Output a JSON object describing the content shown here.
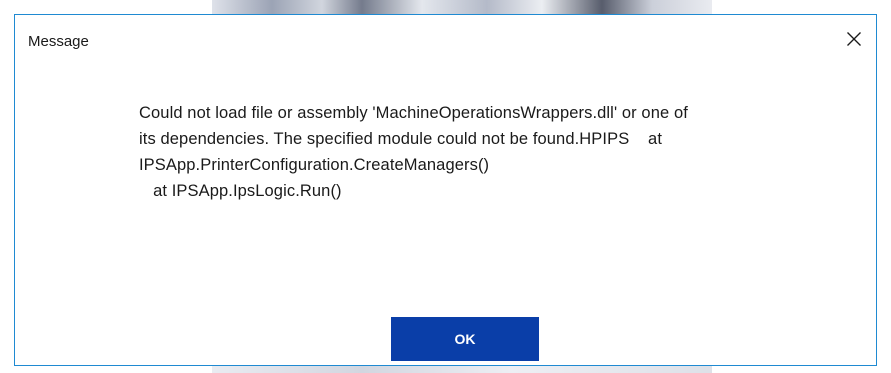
{
  "dialog": {
    "title": "Message",
    "message": "Could not load file or assembly 'MachineOperationsWrappers.dll' or one of\nits dependencies. The specified module could not be found.HPIPS    at\nIPSApp.PrinterConfiguration.CreateManagers()\n   at IPSApp.IpsLogic.Run()",
    "ok_label": "OK",
    "close_icon": "close-icon"
  },
  "colors": {
    "border": "#1f8ad2",
    "ok_button": "#0a3ea8"
  }
}
